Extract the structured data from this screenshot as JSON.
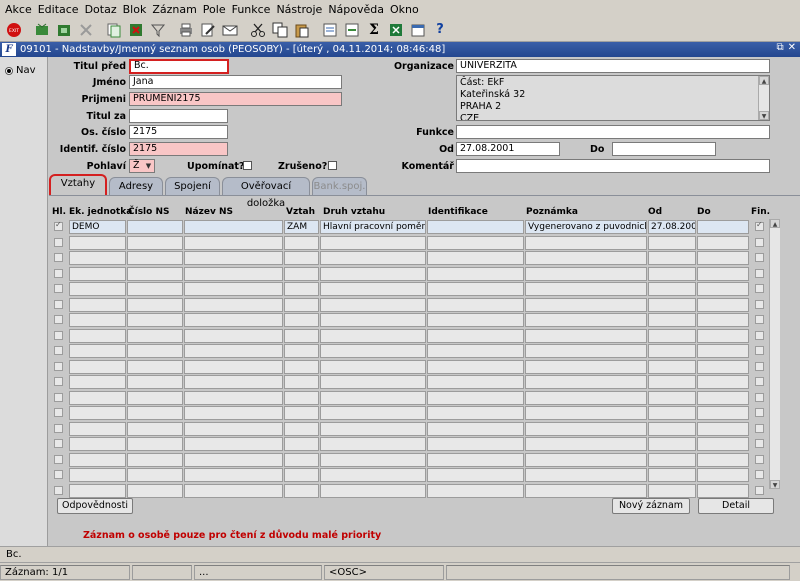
{
  "menu": [
    "Akce",
    "Editace",
    "Dotaz",
    "Blok",
    "Záznam",
    "Pole",
    "Funkce",
    "Nástroje",
    "Nápověda",
    "Okno"
  ],
  "toolbar": {
    "exit_label": "EXIT",
    "sigma": "Σ",
    "help": "?",
    "icons": [
      "exit-icon",
      "save-icon",
      "save-exit-icon",
      "clear-icon",
      "copy-record-icon",
      "delete-record-icon",
      "filter-icon",
      "print-icon",
      "edit-icon",
      "mail-icon",
      "cut-icon",
      "copy-icon",
      "paste-icon",
      "query-icon",
      "execute-query-icon",
      "sum-icon",
      "excel-icon",
      "calendar-icon",
      "help-icon"
    ]
  },
  "window": {
    "title": "09101 - Nadstavby/Jmenný seznam osob (PEOSOBY) - [úterý  , 04.11.2014; 08:46:48]",
    "logo": "F",
    "restore": "⧉",
    "close": "✕"
  },
  "nav": {
    "label": "Nav"
  },
  "form": {
    "titul_pred_label": "Titul před",
    "titul_pred": "Bc.",
    "jmeno_label": "Jméno",
    "jmeno": "Jana",
    "prijmeni_label": "Prijmeni",
    "prijmeni": "PRUMENI2175",
    "titul_za_label": "Titul za",
    "titul_za": "",
    "os_cislo_label": "Os. číslo",
    "os_cislo": "2175",
    "identif_label": "Identif. číslo",
    "identif": "2175",
    "pohlavi_label": "Pohlaví",
    "pohlavi": "Ž",
    "upominat_label": "Upomínat?",
    "zruseno_label": "Zrušeno?",
    "organizace_label": "Organizace",
    "organizace": "UNIVERZITA",
    "adresa": [
      "Část: EkF",
      "Kateřinská 32",
      "PRAHA 2",
      "CZE"
    ],
    "funkce_label": "Funkce",
    "funkce": "",
    "od_label": "Od",
    "od": "27.08.2001",
    "do_label": "Do",
    "do": "",
    "komentar_label": "Komentář",
    "komentar": ""
  },
  "tabs": [
    "Vztahy",
    "Adresy",
    "Spojení",
    "Ověřovací doložka",
    "Bank.spoj."
  ],
  "grid": {
    "headers": [
      "Hl.",
      "Ek. jednotka",
      "Číslo NS",
      "Název NS",
      "Vztah",
      "Druh vztahu",
      "Identifikace",
      "Poznámka",
      "Od",
      "Do",
      "Fin."
    ],
    "rows": [
      {
        "ek": "DEMO",
        "cislo": "",
        "nazev": "",
        "vztah": "ZAM",
        "druh": "Hlavní pracovní poměr",
        "ident": "",
        "pozn": "Vygenerovano z puvodnich dat",
        "od": "27.08.2001",
        "do": ""
      }
    ],
    "empty_rows": 17
  },
  "buttons": {
    "odpovednosti": "Odpovědnosti",
    "novy_zaznam": "Nový záznam",
    "detail": "Detail"
  },
  "message": "Záznam o osobě pouze pro čtení z důvodu malé priority",
  "status": {
    "line1": "Bc.",
    "record": "Záznam: 1/1",
    "dots": "...",
    "osc": "<OSC>"
  }
}
